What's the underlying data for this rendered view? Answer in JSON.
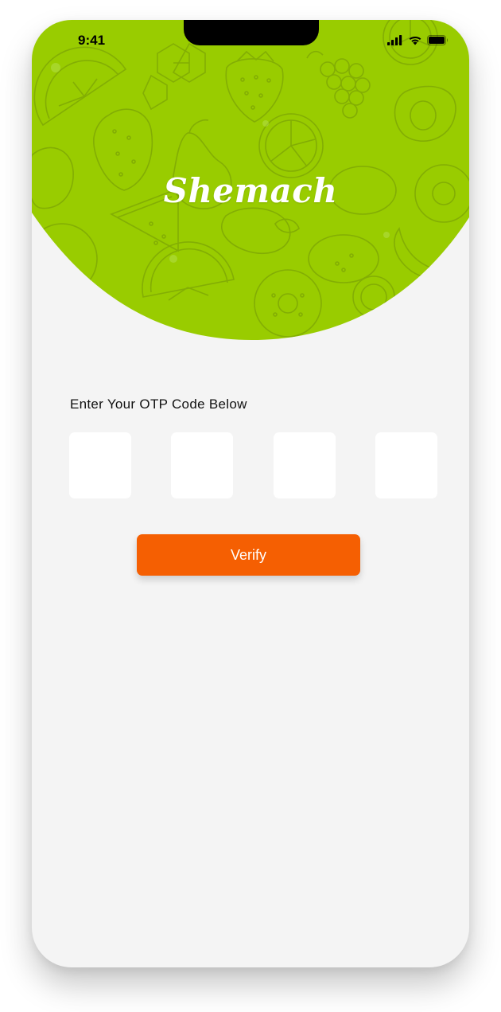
{
  "status_bar": {
    "time": "9:41",
    "icons": [
      "cellular-signal-icon",
      "wifi-icon",
      "battery-icon"
    ]
  },
  "brand": {
    "title": "Shemach"
  },
  "hero": {
    "background_color": "#99cc00",
    "pattern": "fruit-line-art-pattern"
  },
  "otp": {
    "label": "Enter Your OTP Code Below",
    "digits": [
      "",
      "",
      "",
      ""
    ]
  },
  "actions": {
    "verify_label": "Verify",
    "verify_color": "#f55f02"
  }
}
